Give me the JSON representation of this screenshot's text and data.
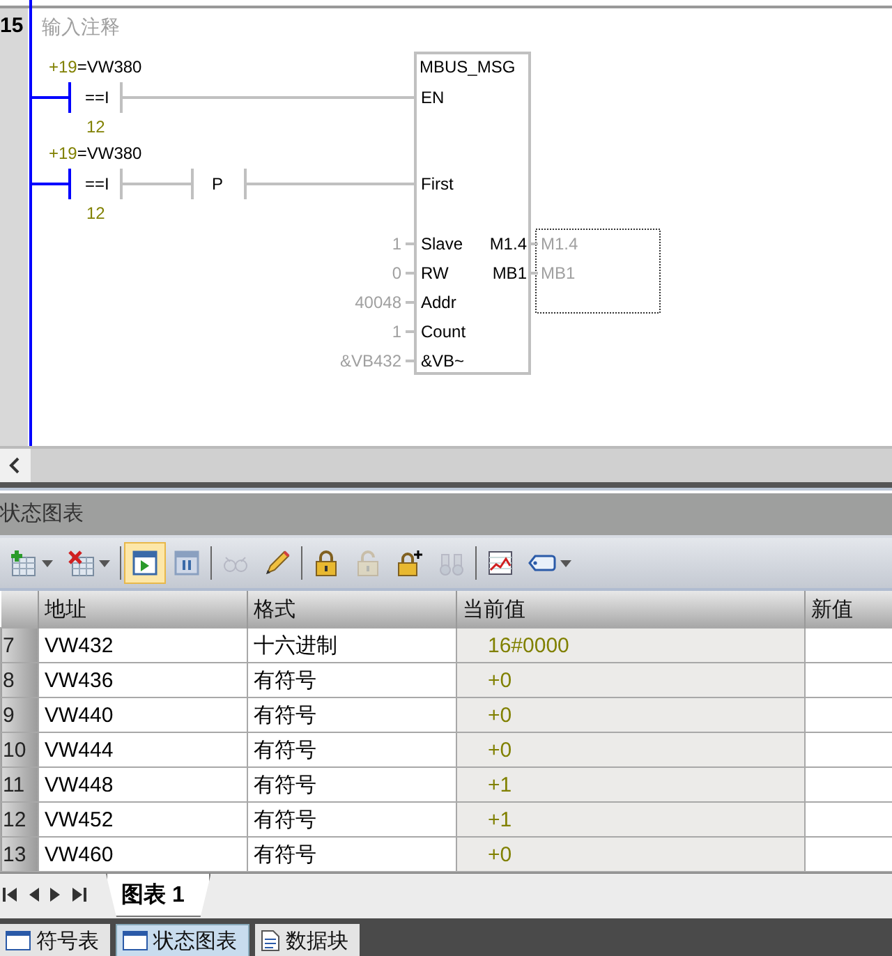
{
  "network": {
    "number": "15",
    "comment": "输入注释",
    "rungs": [
      {
        "contacts": [
          {
            "kind": "compare",
            "value": "+19",
            "operand": "=VW380",
            "symbol": "==I",
            "operand2": "12"
          }
        ]
      },
      {
        "contacts": [
          {
            "kind": "compare",
            "value": "+19",
            "operand": "=VW380",
            "symbol": "==I",
            "operand2": "12"
          },
          {
            "kind": "edge",
            "symbol": "P"
          }
        ]
      }
    ],
    "block": {
      "name": "MBUS_MSG",
      "inputs": [
        {
          "pin": "EN"
        },
        {
          "pin": "First"
        },
        {
          "pin": "Slave",
          "value": "1"
        },
        {
          "pin": "RW",
          "value": "0"
        },
        {
          "pin": "Addr",
          "value": "40048"
        },
        {
          "pin": "Count",
          "value": "1"
        },
        {
          "pin": "&VB~",
          "value": "&VB432"
        }
      ],
      "outputs": [
        {
          "pin": "M1.4",
          "value": "M1.4"
        },
        {
          "pin": "MB1",
          "value": "MB1"
        }
      ]
    }
  },
  "status_chart": {
    "title": "状态图表",
    "toolbar": [
      {
        "kind": "insert-row",
        "selected": false,
        "disabled": false,
        "dropdown": true
      },
      {
        "kind": "delete-row",
        "selected": false,
        "disabled": false,
        "dropdown": true
      },
      {
        "kind": "run",
        "selected": true,
        "disabled": false,
        "dropdown": false
      },
      {
        "kind": "pause",
        "selected": false,
        "disabled": false,
        "dropdown": false
      },
      {
        "kind": "glasses",
        "selected": false,
        "disabled": true,
        "dropdown": false
      },
      {
        "kind": "pencil",
        "selected": false,
        "disabled": false,
        "dropdown": false
      },
      {
        "kind": "lock",
        "selected": false,
        "disabled": false,
        "dropdown": false
      },
      {
        "kind": "unlock",
        "selected": false,
        "disabled": true,
        "dropdown": false
      },
      {
        "kind": "lock-plus",
        "selected": false,
        "disabled": false,
        "dropdown": false
      },
      {
        "kind": "binoculars",
        "selected": false,
        "disabled": true,
        "dropdown": false
      },
      {
        "kind": "trend",
        "selected": false,
        "disabled": false,
        "dropdown": false
      },
      {
        "kind": "tag",
        "selected": false,
        "disabled": false,
        "dropdown": true
      }
    ],
    "table": {
      "columns": [
        "地址",
        "格式",
        "当前值",
        "新值"
      ],
      "rows": [
        {
          "number": "7",
          "address": "VW432",
          "format": "十六进制",
          "current": "16#0000"
        },
        {
          "number": "8",
          "address": "VW436",
          "format": "有符号",
          "current": "+0"
        },
        {
          "number": "9",
          "address": "VW440",
          "format": "有符号",
          "current": "+0"
        },
        {
          "number": "10",
          "address": "VW444",
          "format": "有符号",
          "current": "+0"
        },
        {
          "number": "11",
          "address": "VW448",
          "format": "有符号",
          "current": "+1"
        },
        {
          "number": "12",
          "address": "VW452",
          "format": "有符号",
          "current": "+1"
        },
        {
          "number": "13",
          "address": "VW460",
          "format": "有符号",
          "current": "+0"
        }
      ]
    },
    "sheet_tabs": [
      {
        "label": "图表 1",
        "selected": true
      }
    ]
  },
  "bottom_tabs": [
    {
      "label": "符号表",
      "selected": false,
      "kind": "table"
    },
    {
      "label": "状态图表",
      "selected": true,
      "kind": "table"
    },
    {
      "label": "数据块",
      "selected": false,
      "kind": "document"
    }
  ]
}
